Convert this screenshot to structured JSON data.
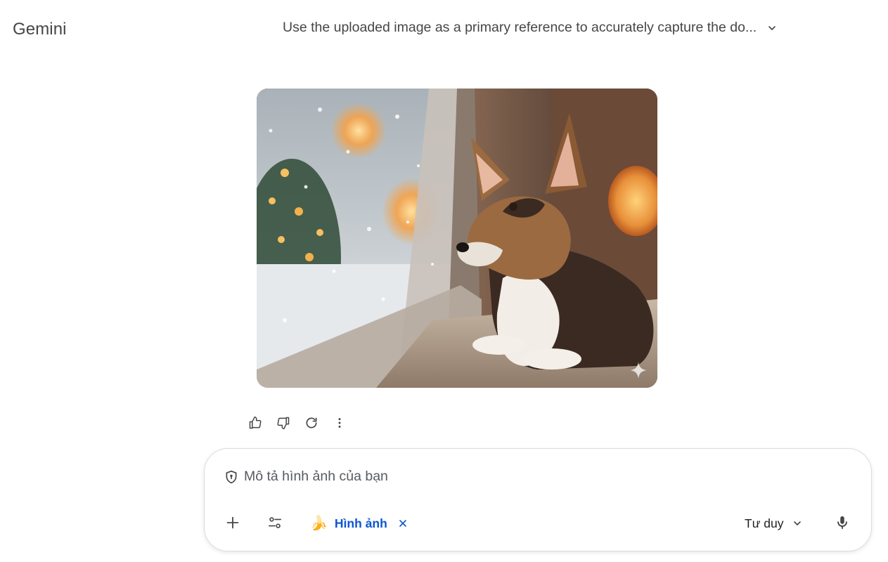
{
  "header": {
    "brand": "Gemini",
    "conversation_title": "Use the uploaded image as a primary reference to accurately capture the do..."
  },
  "response": {
    "image": {
      "subject": "corgi-by-snowy-window",
      "badge_icon": "sparkle-icon"
    },
    "actions": [
      {
        "name": "thumbs-up-icon"
      },
      {
        "name": "thumbs-down-icon"
      },
      {
        "name": "regenerate-icon"
      },
      {
        "name": "more-vert-icon"
      }
    ]
  },
  "composer": {
    "placeholder": "Mô tả hình ảnh của bạn",
    "tool_chip": {
      "label": "Hình ảnh",
      "emoji": "🍌"
    },
    "mode": "Tư duy"
  },
  "colors": {
    "accent": "#0b57d0",
    "text_secondary": "#444746",
    "border": "#dadce0"
  }
}
